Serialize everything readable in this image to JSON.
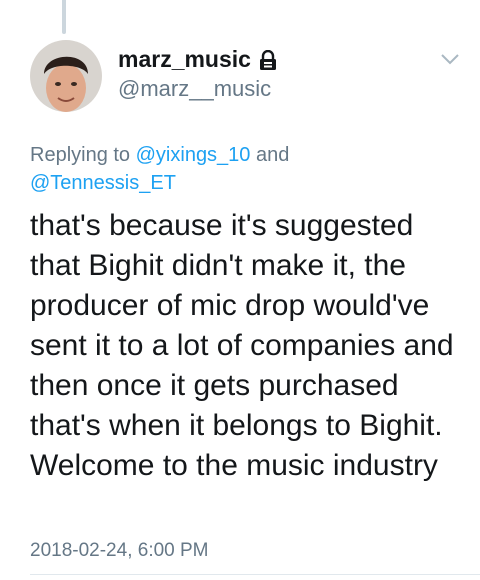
{
  "tweet": {
    "display_name": "marz_music",
    "handle": "@marz__music",
    "reply_prefix": "Replying to",
    "reply_to": [
      "@yixings_10",
      "@Tennessis_ET"
    ],
    "reply_joiner": "and",
    "text_lines": [
      "that's because it's suggested",
      "that Bighit didn't make it, the",
      "producer of mic drop would've",
      "sent it to a lot of companies and",
      "then once it gets purchased",
      "that's when it belongs to Bighit.",
      "Welcome to the music industry"
    ],
    "timestamp": "2018-02-24, 6:00 PM"
  },
  "icons": {
    "lock": "lock-icon",
    "menu": "chevron-down-icon"
  },
  "colors": {
    "text": "#14171a",
    "secondary": "#657786",
    "link": "#1da1f2",
    "thread_line": "#ccd6dd"
  }
}
